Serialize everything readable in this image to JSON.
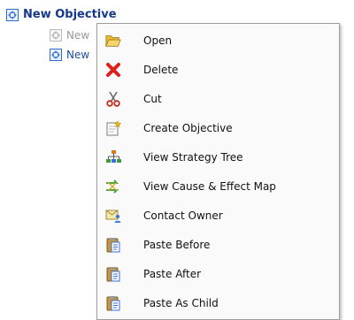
{
  "tree": {
    "root_label": "New Objective",
    "children": [
      {
        "label": "New",
        "icon": "objective-icon-disabled"
      },
      {
        "label": "New",
        "icon": "objective-icon"
      }
    ]
  },
  "context_menu": {
    "items": [
      {
        "label": "Open",
        "icon": "folder-open-icon"
      },
      {
        "label": "Delete",
        "icon": "delete-x-icon"
      },
      {
        "label": "Cut",
        "icon": "scissors-icon"
      },
      {
        "label": "Create Objective",
        "icon": "create-objective-icon"
      },
      {
        "label": "View Strategy Tree",
        "icon": "strategy-tree-icon"
      },
      {
        "label": "View Cause & Effect Map",
        "icon": "cause-effect-map-icon"
      },
      {
        "label": "Contact Owner",
        "icon": "contact-owner-icon"
      },
      {
        "label": "Paste Before",
        "icon": "paste-before-icon"
      },
      {
        "label": "Paste After",
        "icon": "paste-after-icon"
      },
      {
        "label": "Paste As Child",
        "icon": "paste-as-child-icon"
      }
    ]
  },
  "colors": {
    "accent": "#2d6ad1",
    "delete_red": "#e0201b",
    "menu_border": "#9d9d9d"
  }
}
